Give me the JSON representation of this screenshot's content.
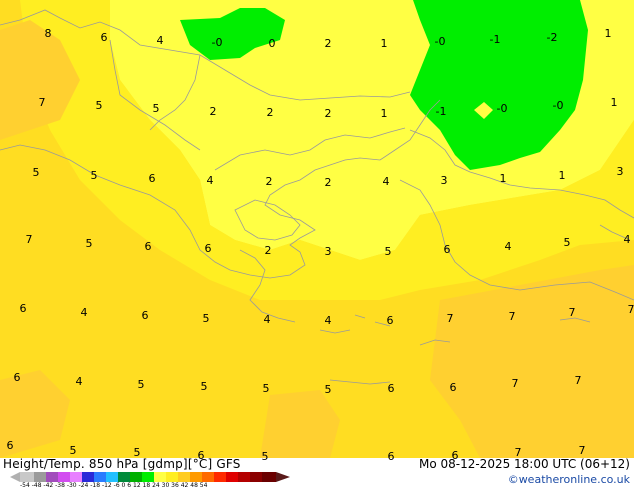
{
  "title": "Height/Temp. 850 hPa [gdmp][°C] GFS",
  "datetime": "Mo 08-12-2025 18:00 UTC (06+12)",
  "credit": "©weatheronline.co.uk",
  "colorbar_ticks": "-54 -48 -42 -38 -30 -24 -18 -12 -6  0  6  12  18  24  30  36  42  48  54",
  "colors": {
    "yellow_light": "#ffff44",
    "yellow": "#ffee22",
    "yellow_orange": "#ffdd22",
    "orange_yellow": "#ffd030",
    "green": "#00ee00",
    "border": "#9a9a9a"
  },
  "labels": [
    {
      "text": "8"
    },
    {
      "text": "6"
    },
    {
      "text": "4"
    },
    {
      "text": "-0"
    },
    {
      "text": "0"
    },
    {
      "text": "2"
    },
    {
      "text": "1"
    },
    {
      "text": "-0"
    },
    {
      "text": "-1"
    },
    {
      "text": "-2"
    },
    {
      "text": "1"
    },
    {
      "text": "7"
    },
    {
      "text": "5"
    },
    {
      "text": "5"
    },
    {
      "text": "2"
    },
    {
      "text": "2"
    },
    {
      "text": "2"
    },
    {
      "text": "1"
    },
    {
      "text": "-1"
    },
    {
      "text": "-0"
    },
    {
      "text": "-0"
    },
    {
      "text": "1"
    },
    {
      "text": "5"
    },
    {
      "text": "5"
    },
    {
      "text": "6"
    },
    {
      "text": "4"
    },
    {
      "text": "2"
    },
    {
      "text": "2"
    },
    {
      "text": "4"
    },
    {
      "text": "3"
    },
    {
      "text": "1"
    },
    {
      "text": "1"
    },
    {
      "text": "3"
    },
    {
      "text": "7"
    },
    {
      "text": "5"
    },
    {
      "text": "6"
    },
    {
      "text": "6"
    },
    {
      "text": "2"
    },
    {
      "text": "3"
    },
    {
      "text": "5"
    },
    {
      "text": "6"
    },
    {
      "text": "4"
    },
    {
      "text": "5"
    },
    {
      "text": "4"
    },
    {
      "text": "6"
    },
    {
      "text": "4"
    },
    {
      "text": "6"
    },
    {
      "text": "5"
    },
    {
      "text": "4"
    },
    {
      "text": "4"
    },
    {
      "text": "6"
    },
    {
      "text": "7"
    },
    {
      "text": "7"
    },
    {
      "text": "7"
    },
    {
      "text": "7"
    },
    {
      "text": "6"
    },
    {
      "text": "4"
    },
    {
      "text": "5"
    },
    {
      "text": "5"
    },
    {
      "text": "5"
    },
    {
      "text": "5"
    },
    {
      "text": "6"
    },
    {
      "text": "6"
    },
    {
      "text": "7"
    },
    {
      "text": "7"
    },
    {
      "text": "6"
    },
    {
      "text": "5"
    },
    {
      "text": "5"
    },
    {
      "text": "6"
    },
    {
      "text": "5"
    },
    {
      "text": "6"
    },
    {
      "text": "6"
    },
    {
      "text": "7"
    },
    {
      "text": "7"
    },
    {
      "text": "6"
    }
  ]
}
